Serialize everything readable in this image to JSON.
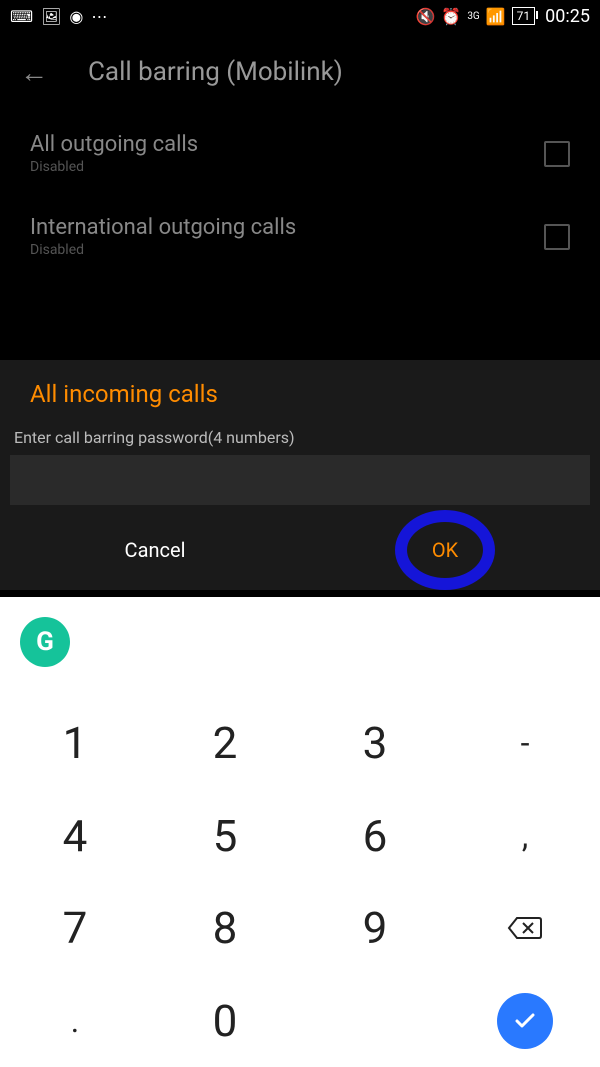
{
  "status_bar": {
    "time": "00:25",
    "battery": "71",
    "signal_label": "3G"
  },
  "page": {
    "title": "Call barring (Mobilink)"
  },
  "settings": [
    {
      "label": "All outgoing calls",
      "status": "Disabled"
    },
    {
      "label": "International outgoing calls",
      "status": "Disabled"
    }
  ],
  "dialog": {
    "title": "All incoming calls",
    "label": "Enter call barring password(4 numbers)",
    "cancel": "Cancel",
    "ok": "OK",
    "value": ""
  },
  "keypad": {
    "grammarly": "G",
    "keys": [
      "1",
      "2",
      "3",
      "-",
      "4",
      "5",
      "6",
      ",",
      "7",
      "8",
      "9",
      "⌫",
      ".",
      "0",
      " ",
      "✓"
    ]
  }
}
